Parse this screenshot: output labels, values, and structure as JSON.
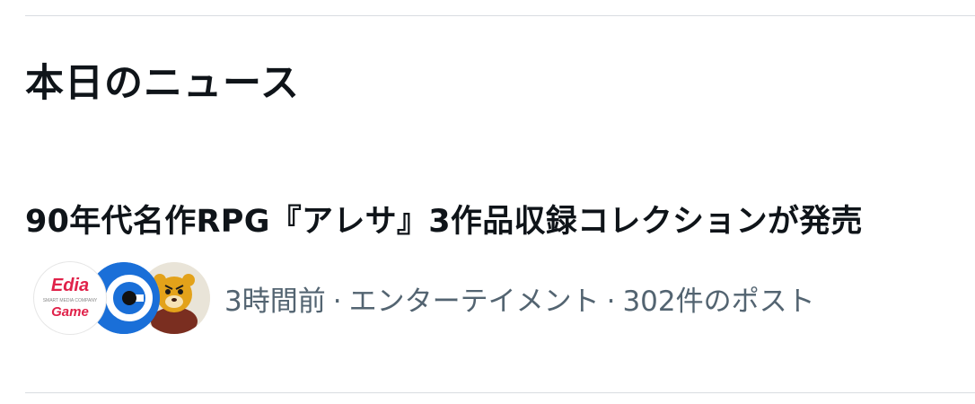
{
  "section": {
    "title": "本日のニュース"
  },
  "news": [
    {
      "headline": "90年代名作RPG『アレサ』3作品収録コレクションが発売",
      "time": "3時間前",
      "category": "エンターテイメント",
      "posts": "302件のポスト",
      "separator": "·",
      "avatars": [
        {
          "name": "edia-logo",
          "logo_text_main": "Edia",
          "logo_text_sub": "SMART MEDIA COMPANY",
          "logo_text_game": "Game",
          "brand_color": "#e0224a"
        },
        {
          "name": "blue-logo",
          "brand_color": "#1a6fd8"
        },
        {
          "name": "mascot-character",
          "brand_color": "#e3a21a"
        }
      ]
    }
  ]
}
